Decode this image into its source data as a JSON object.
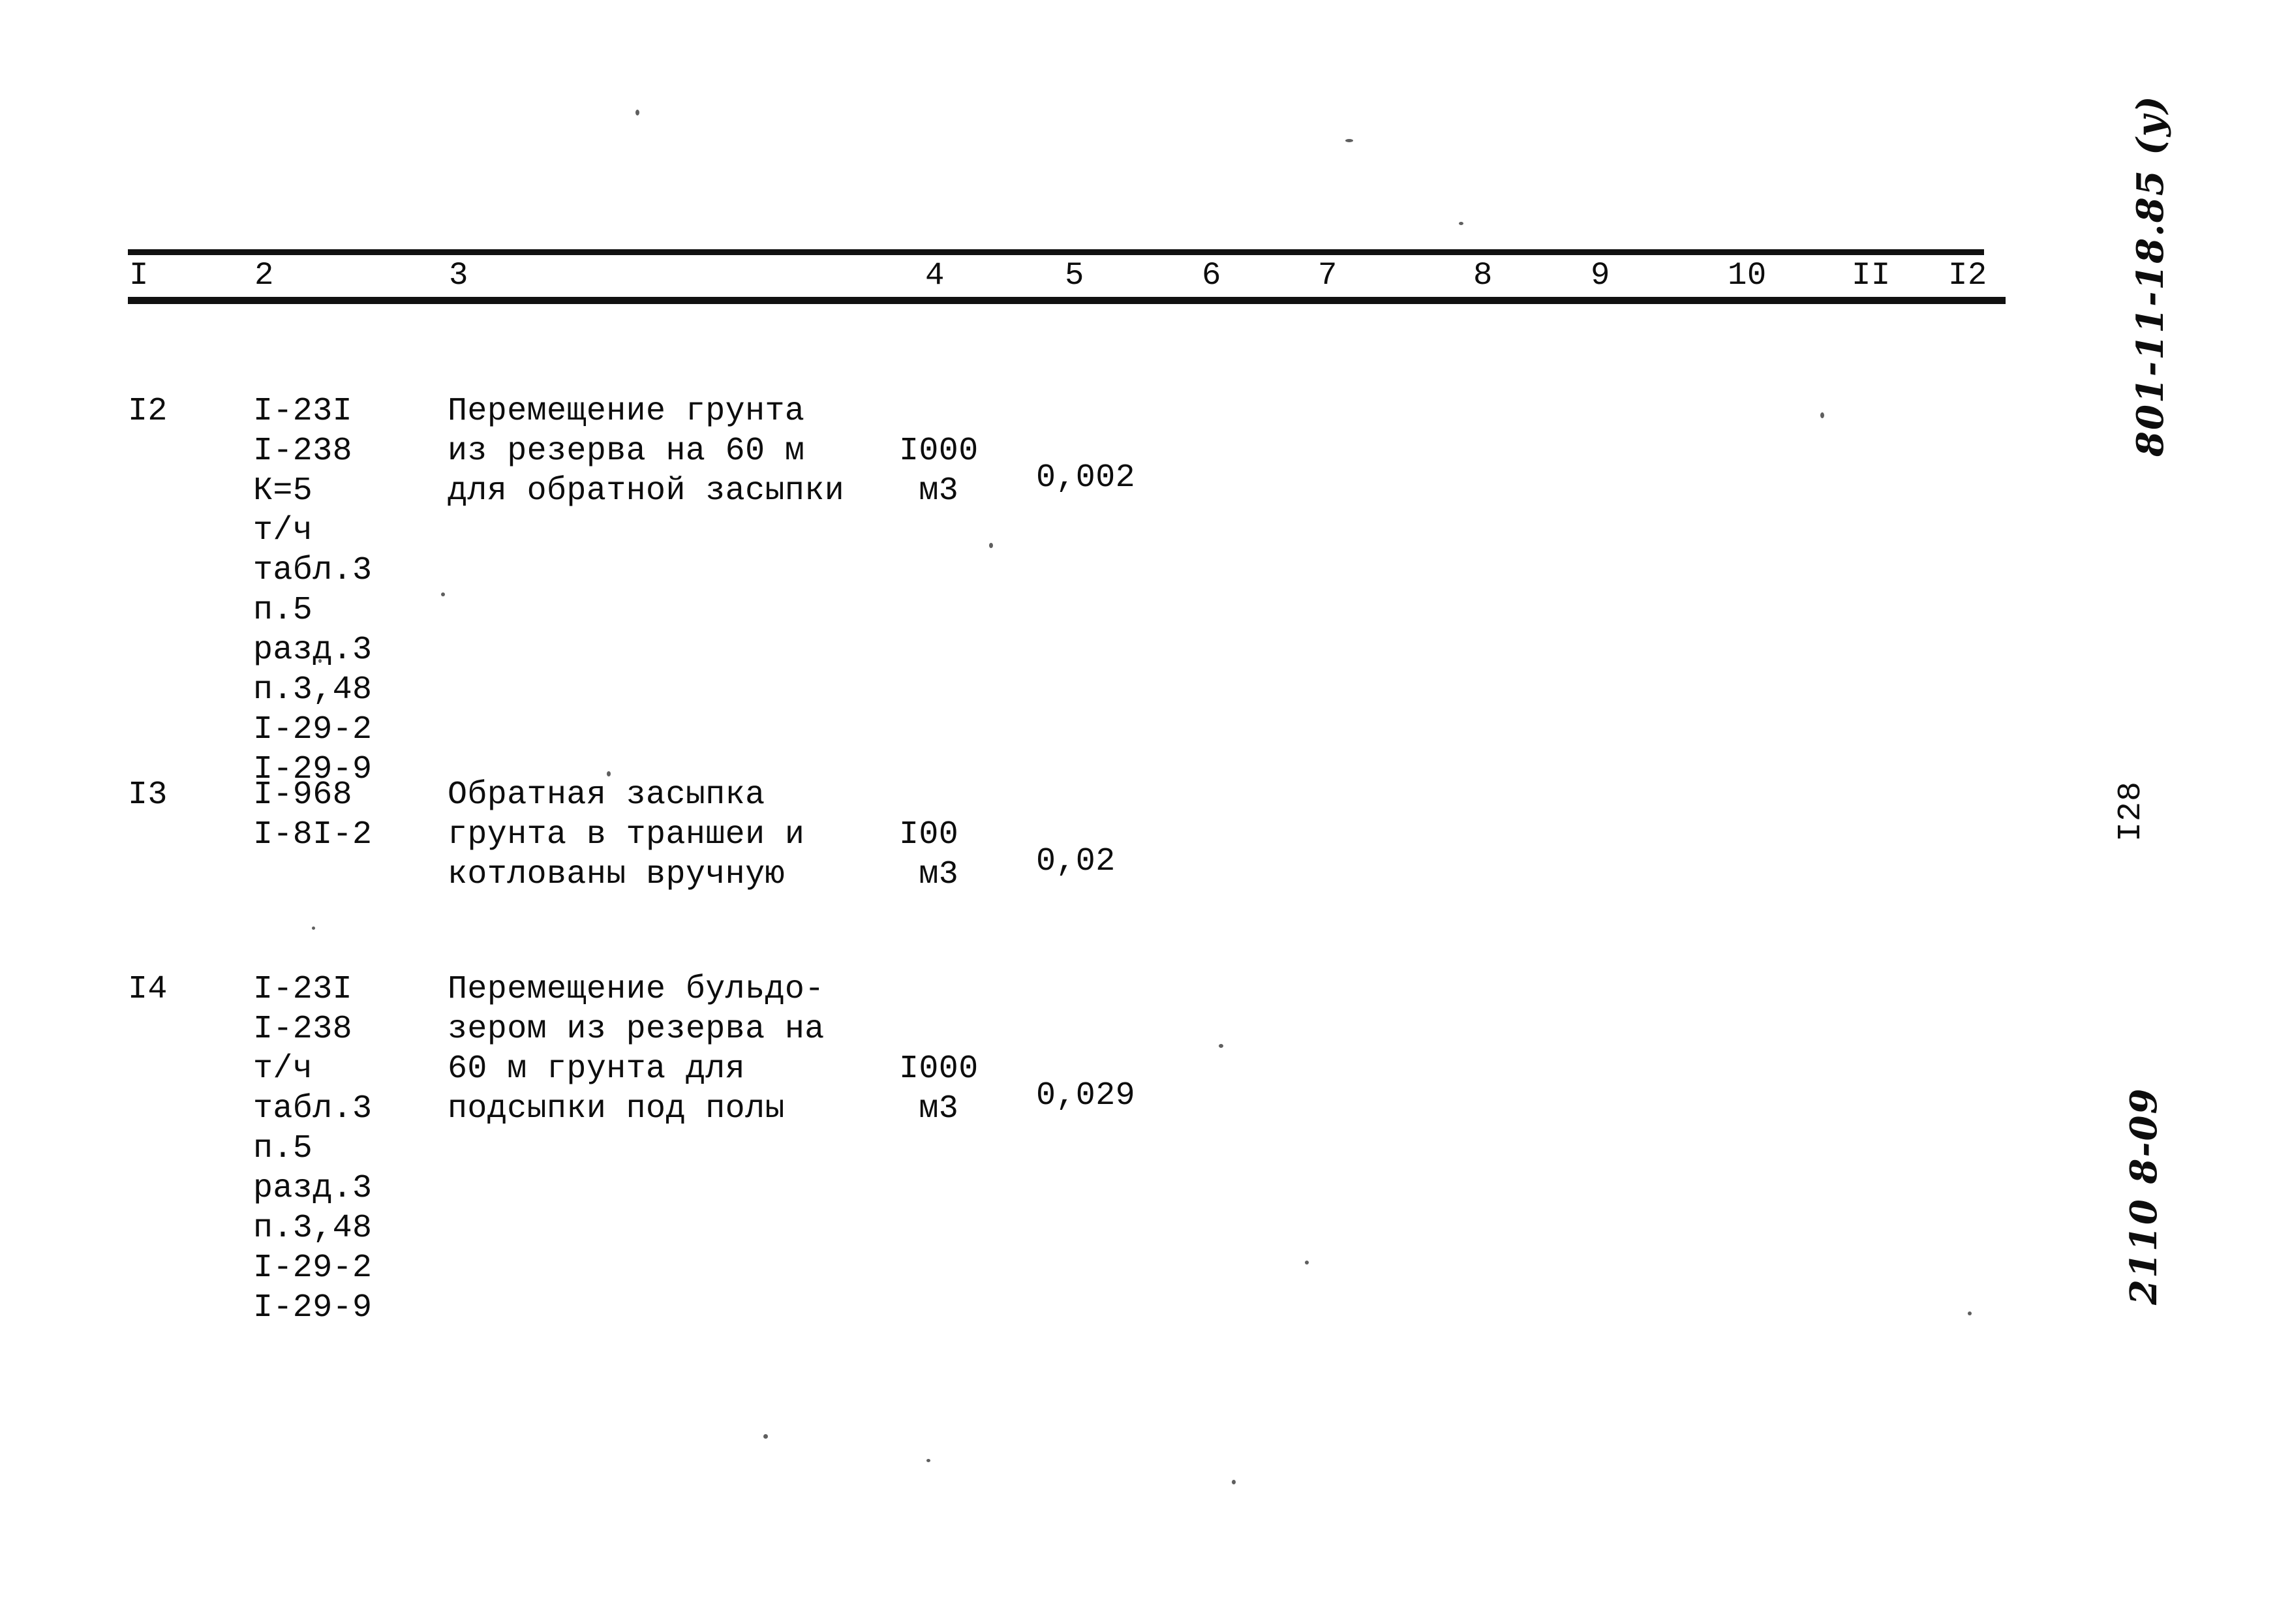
{
  "document": {
    "kind": "scanned-typewritten-estimate-table",
    "page_number_margin": "I28",
    "margin_code_top": "801-11-18.85 (у)",
    "margin_code_bottom": "2110 8-09"
  },
  "table": {
    "column_headers": [
      "I",
      "2",
      "3",
      "4",
      "5",
      "6",
      "7",
      "8",
      "9",
      "10",
      "II",
      "I2"
    ],
    "rows": [
      {
        "num": "I2",
        "codes": [
          "I-23I",
          "I-238",
          "К=5",
          "т/ч",
          "табл.3",
          "п.5",
          "разд.3",
          "п.3,48",
          "I-29-2",
          "I-29-9"
        ],
        "description": [
          "Перемещение грунта",
          "из резерва на 60 м",
          "для обратной засыпки"
        ],
        "unit": [
          "1000",
          "м3"
        ],
        "quantity": "0,002",
        "col6": "",
        "col7": "",
        "col8": "",
        "col9": "",
        "col10": "",
        "col11": "",
        "col12": ""
      },
      {
        "num": "I3",
        "codes": [
          "I-968",
          "I-8I-2"
        ],
        "description": [
          "Обратная засыпка",
          "грунта в траншеи и",
          "котлованы вручную"
        ],
        "unit": [
          "100",
          "м3"
        ],
        "quantity": "0,02",
        "col6": "",
        "col7": "",
        "col8": "",
        "col9": "",
        "col10": "",
        "col11": "",
        "col12": ""
      },
      {
        "num": "I4",
        "codes": [
          "I-23I",
          "I-238",
          "т/ч",
          "табл.3",
          "п.5",
          "разд.3",
          "п.3,48",
          "I-29-2",
          "I-29-9"
        ],
        "description": [
          "Перемещение бульдо-",
          "зером из резерва на",
          "60 м грунта для",
          "подсыпки под полы"
        ],
        "unit": [
          "1000",
          "м3"
        ],
        "quantity": "0,029",
        "col6": "",
        "col7": "",
        "col8": "",
        "col9": "",
        "col10": "",
        "col11": "",
        "col12": ""
      }
    ]
  },
  "render": {
    "row12_codes_text": "I-23I\nI-238\nК=5\nт/ч\nтабл.3\nп.5\nразд.3\nп.3,48\nI-29-2\nI-29-9",
    "row12_desc_text": "Перемещение грунта\nиз резерва на 60 м\nдля обратной засыпки",
    "row12_unit_text": "I000\n м3",
    "row13_codes_text": "I-968\nI-8I-2",
    "row13_desc_text": "Обратная засыпка\nгрунта в траншеи и\nкотлованы вручную",
    "row13_unit_text": "I00\n м3",
    "row14_codes_text": "I-23I\nI-238\nт/ч\nтабл.3\nп.5\nразд.3\nп.3,48\nI-29-2\nI-29-9",
    "row14_desc_text": "Перемещение бульдо-\nзером из резерва на\n60 м грунта для\nподсыпки под полы",
    "row14_unit_text": "I000\n м3"
  }
}
